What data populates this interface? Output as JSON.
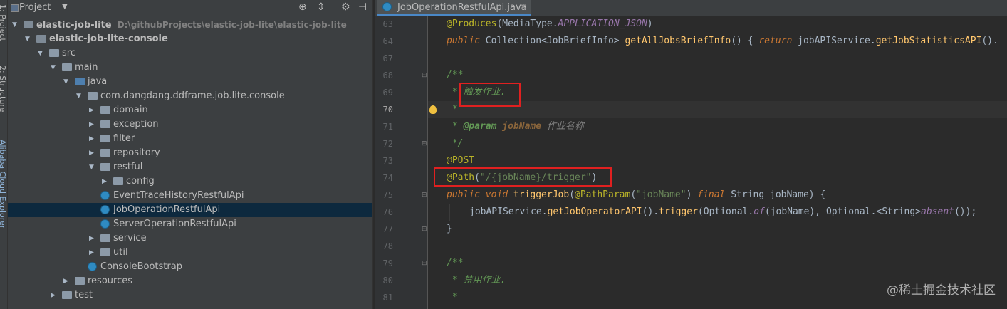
{
  "side_strip": {
    "tabs": [
      "1: Project",
      "2: Structure",
      "Alibaba Cloud Explorer"
    ]
  },
  "project_panel": {
    "title": "Project",
    "header_icons": [
      "target-icon",
      "collapse-icon",
      "gear-icon",
      "hide-icon"
    ],
    "tree": [
      {
        "label": "elastic-job-lite",
        "path": "D:\\githubProjects\\elastic-job-lite\\elastic-job-lite",
        "depth": 0,
        "arrow": "down",
        "icon": "module-folder",
        "bold": true
      },
      {
        "label": "elastic-job-lite-console",
        "depth": 1,
        "arrow": "down",
        "icon": "module-folder",
        "bold": true
      },
      {
        "label": "src",
        "depth": 2,
        "arrow": "down",
        "icon": "folder"
      },
      {
        "label": "main",
        "depth": 3,
        "arrow": "down",
        "icon": "folder"
      },
      {
        "label": "java",
        "depth": 4,
        "arrow": "down",
        "icon": "source-folder"
      },
      {
        "label": "com.dangdang.ddframe.job.lite.console",
        "depth": 5,
        "arrow": "down",
        "icon": "package"
      },
      {
        "label": "domain",
        "depth": 6,
        "arrow": "right",
        "icon": "package"
      },
      {
        "label": "exception",
        "depth": 6,
        "arrow": "right",
        "icon": "package"
      },
      {
        "label": "filter",
        "depth": 6,
        "arrow": "right",
        "icon": "package"
      },
      {
        "label": "repository",
        "depth": 6,
        "arrow": "right",
        "icon": "package"
      },
      {
        "label": "restful",
        "depth": 6,
        "arrow": "down",
        "icon": "package"
      },
      {
        "label": "config",
        "depth": 7,
        "arrow": "right",
        "icon": "package"
      },
      {
        "label": "EventTraceHistoryRestfulApi",
        "depth": 7,
        "arrow": "",
        "icon": "class"
      },
      {
        "label": "JobOperationRestfulApi",
        "depth": 7,
        "arrow": "",
        "icon": "class",
        "selected": true
      },
      {
        "label": "ServerOperationRestfulApi",
        "depth": 7,
        "arrow": "",
        "icon": "class"
      },
      {
        "label": "service",
        "depth": 6,
        "arrow": "right",
        "icon": "package"
      },
      {
        "label": "util",
        "depth": 6,
        "arrow": "right",
        "icon": "package"
      },
      {
        "label": "ConsoleBootstrap",
        "depth": 6,
        "arrow": "",
        "icon": "class"
      },
      {
        "label": "resources",
        "depth": 4,
        "arrow": "right",
        "icon": "folder"
      },
      {
        "label": "test",
        "depth": 3,
        "arrow": "right",
        "icon": "folder"
      }
    ]
  },
  "editor": {
    "tab_label": "JobOperationRestfulApi.java",
    "current_line": "70",
    "lines": [
      {
        "n": "63",
        "tokens": [
          [
            "ann",
            "@Produces"
          ],
          [
            "typ",
            "(MediaType."
          ],
          [
            "itf",
            "APPLICATION_JSON"
          ],
          [
            "typ",
            ")"
          ]
        ],
        "indent": 0
      },
      {
        "n": "64",
        "tokens": [
          [
            "kw",
            "public "
          ],
          [
            "typ",
            "Collection<JobBriefInfo> "
          ],
          [
            "mth",
            "getAllJobsBriefInfo"
          ],
          [
            "typ",
            "() { "
          ],
          [
            "kw",
            "return "
          ],
          [
            "typ",
            "jobAPIService."
          ],
          [
            "callm",
            "getJobStatisticsAPI"
          ],
          [
            "typ",
            "()."
          ]
        ],
        "indent": 0
      },
      {
        "n": "67",
        "tokens": [],
        "indent": 0
      },
      {
        "n": "68",
        "tokens": [
          [
            "cm",
            "/**"
          ]
        ],
        "indent": 0
      },
      {
        "n": "69",
        "tokens": [
          [
            "cm",
            " * 触发作业."
          ]
        ],
        "indent": 0
      },
      {
        "n": "70",
        "tokens": [
          [
            "cm",
            " *"
          ]
        ],
        "indent": 0
      },
      {
        "n": "71",
        "tokens": [
          [
            "cm",
            " * "
          ],
          [
            "cmtag",
            "@param "
          ],
          [
            "cmref",
            "jobName "
          ],
          [
            "gray",
            "作业名称"
          ]
        ],
        "indent": 0
      },
      {
        "n": "72",
        "tokens": [
          [
            "cm",
            " */"
          ]
        ],
        "indent": 0
      },
      {
        "n": "73",
        "tokens": [
          [
            "ann",
            "@POST"
          ]
        ],
        "indent": 0
      },
      {
        "n": "74",
        "tokens": [
          [
            "ann",
            "@Path"
          ],
          [
            "typ",
            "("
          ],
          [
            "str",
            "\"/{jobName}/trigger\""
          ],
          [
            "typ",
            ")"
          ]
        ],
        "indent": 0
      },
      {
        "n": "75",
        "tokens": [
          [
            "kw",
            "public void "
          ],
          [
            "mth",
            "triggerJob"
          ],
          [
            "typ",
            "("
          ],
          [
            "ann",
            "@PathParam"
          ],
          [
            "typ",
            "("
          ],
          [
            "str",
            "\"jobName\""
          ],
          [
            "typ",
            ") "
          ],
          [
            "kw",
            "final "
          ],
          [
            "typ",
            "String jobName) {"
          ]
        ],
        "indent": 0
      },
      {
        "n": "76",
        "tokens": [
          [
            "typ",
            "jobAPIService."
          ],
          [
            "callm",
            "getJobOperatorAPI"
          ],
          [
            "typ",
            "()."
          ],
          [
            "callm",
            "trigger"
          ],
          [
            "typ",
            "(Optional."
          ],
          [
            "itf",
            "of"
          ],
          [
            "typ",
            "(jobName), Optional.<String>"
          ],
          [
            "itf",
            "absent"
          ],
          [
            "typ",
            "());"
          ]
        ],
        "indent": 1
      },
      {
        "n": "77",
        "tokens": [
          [
            "typ",
            "}"
          ]
        ],
        "indent": 0
      },
      {
        "n": "78",
        "tokens": [],
        "indent": 0
      },
      {
        "n": "79",
        "tokens": [
          [
            "cm",
            "/**"
          ]
        ],
        "indent": 0
      },
      {
        "n": "80",
        "tokens": [
          [
            "cm",
            " * 禁用作业."
          ]
        ],
        "indent": 0
      },
      {
        "n": "81",
        "tokens": [
          [
            "cm",
            " *"
          ]
        ],
        "indent": 0
      }
    ]
  },
  "colors": {
    "highlight_box": "#e02020",
    "selection": "#0d293e",
    "tab_underline": "#4a88c7"
  },
  "watermark": "@稀土掘金技术社区"
}
